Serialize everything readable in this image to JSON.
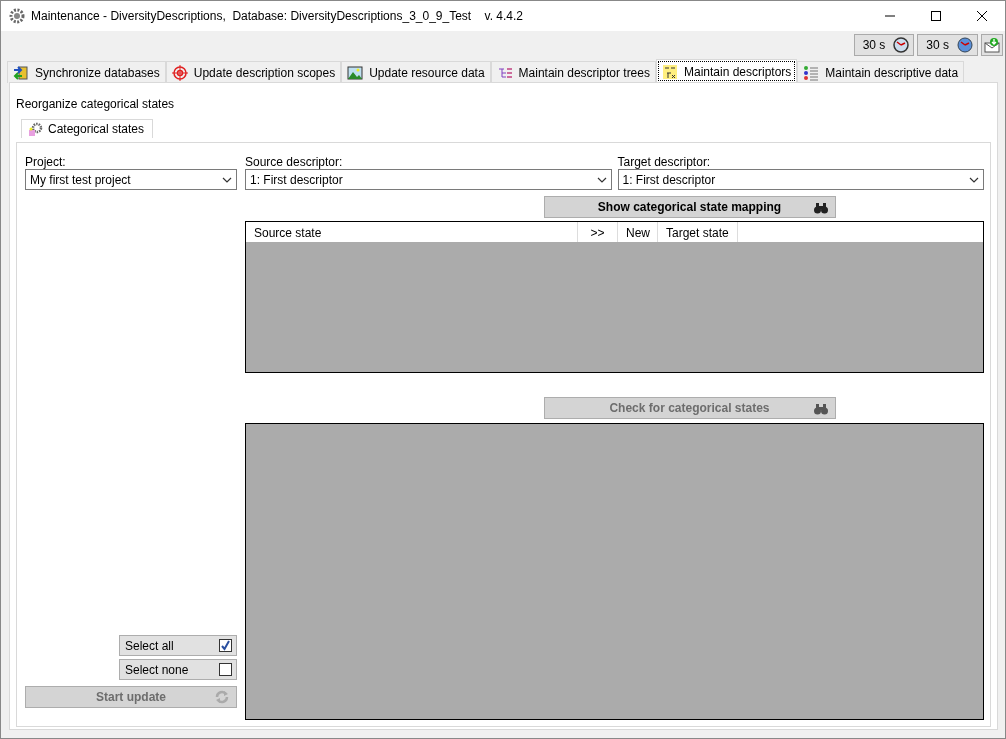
{
  "window": {
    "title": "Maintenance - DiversityDescriptions,  Database: DiversityDescriptions_3_0_9_Test    v. 4.4.2"
  },
  "toolbar": [
    {
      "label": "30 s",
      "kind": "clock"
    },
    {
      "label": "30 s",
      "kind": "globe"
    },
    {
      "kind": "mail"
    }
  ],
  "tabs": [
    {
      "label": "Synchronize databases",
      "kind": "sync",
      "selected": false
    },
    {
      "label": "Update description scopes",
      "kind": "target",
      "selected": false
    },
    {
      "label": "Update resource data",
      "kind": "image",
      "selected": false
    },
    {
      "label": "Maintain descriptor trees",
      "kind": "tree",
      "selected": false
    },
    {
      "label": "Maintain descriptors",
      "kind": "descriptor",
      "selected": true
    },
    {
      "label": "Maintain descriptive data",
      "kind": "list",
      "selected": false
    }
  ],
  "section_title": "Reorganize categorical states",
  "inner_tabs": [
    {
      "label": "Categorical states",
      "selected": true
    }
  ],
  "fields": [
    {
      "label": "Project:",
      "value": "My first test project"
    },
    {
      "label": "Source descriptor:",
      "value": "1: First descriptor"
    },
    {
      "label": "Target descriptor:",
      "value": "1: First descriptor"
    }
  ],
  "mapping_button": {
    "label": "Show categorical state mapping",
    "disabled": false
  },
  "mapping_table": {
    "columns": [
      "Source state",
      ">>",
      "New",
      "Target state"
    ]
  },
  "check_button": {
    "label": "Check for categorical states",
    "disabled": true
  },
  "select_all": {
    "label": "Select all",
    "checked": true
  },
  "select_none": {
    "label": "Select none",
    "checked": false
  },
  "start_button": {
    "label": "Start update",
    "disabled": true
  }
}
